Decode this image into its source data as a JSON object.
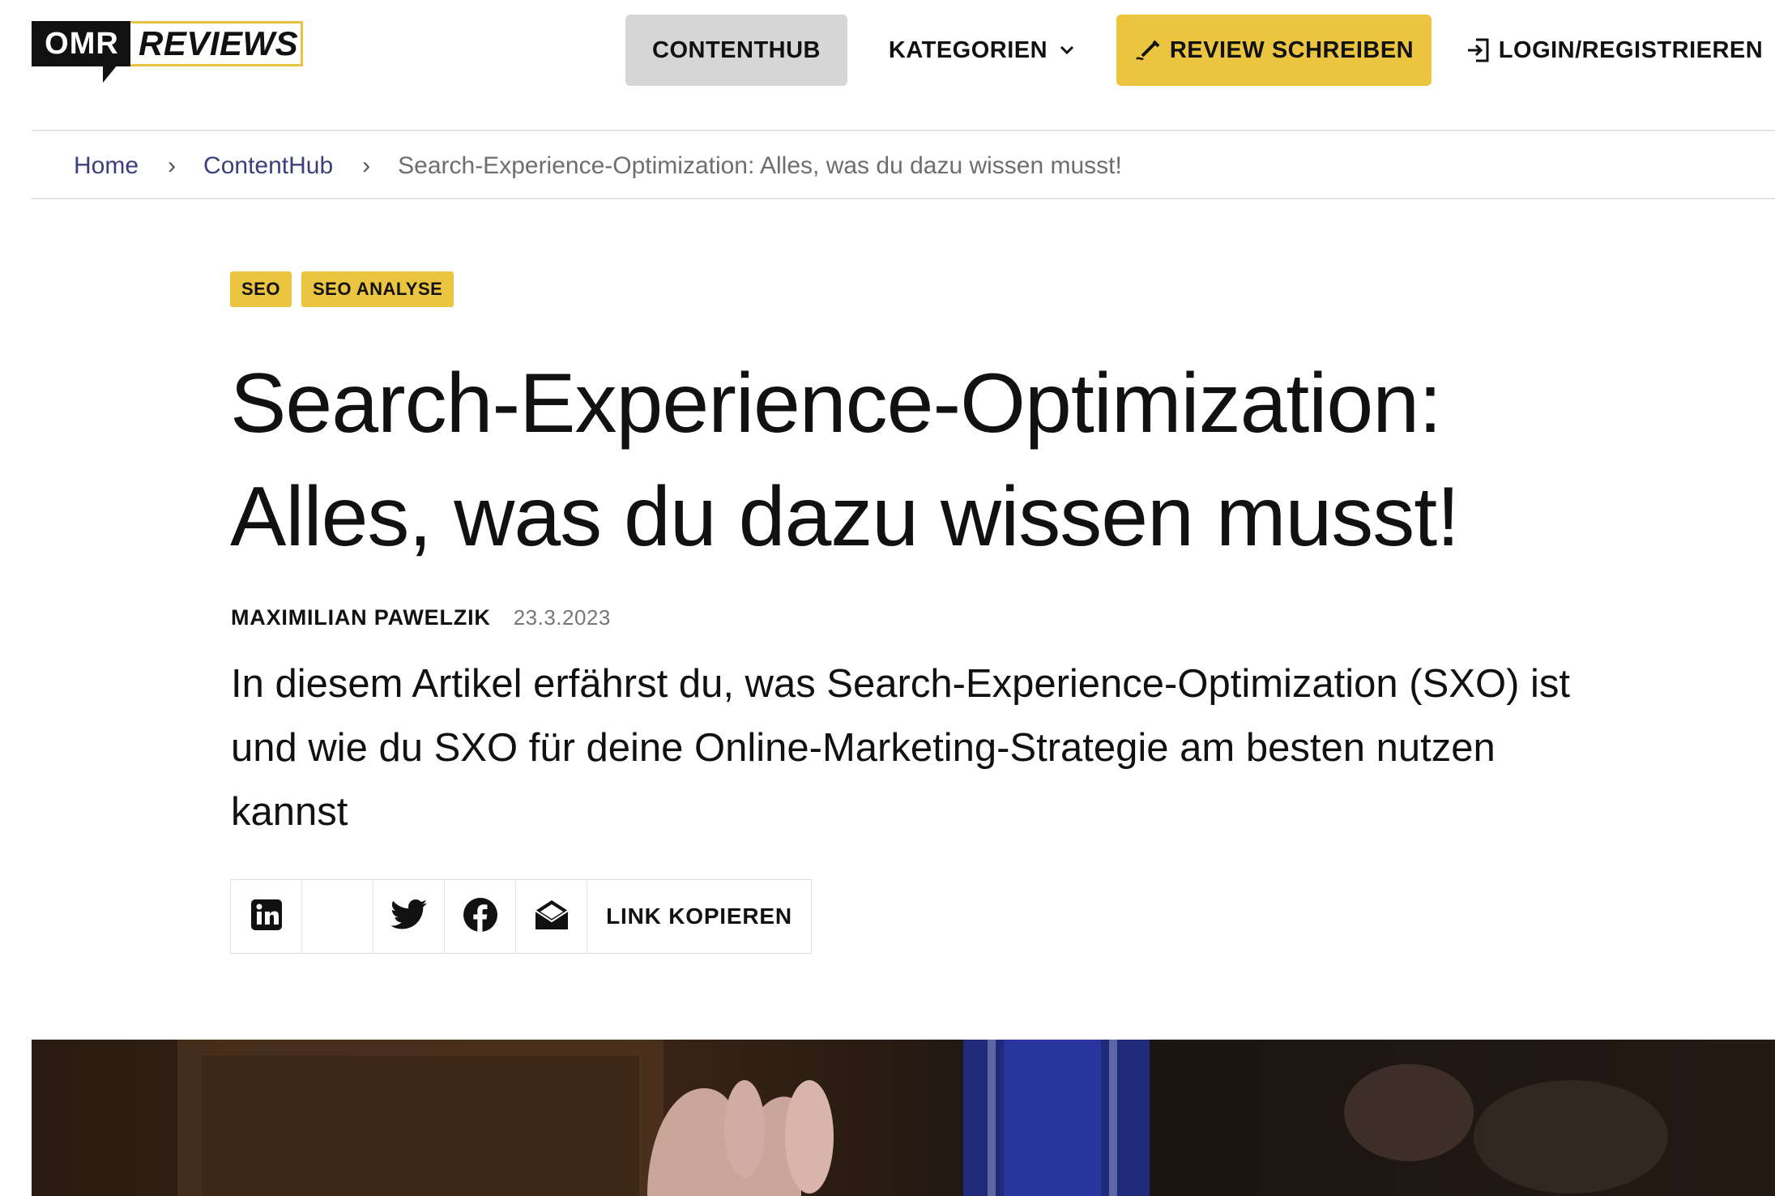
{
  "header": {
    "logo_left": "OMR",
    "logo_right": "REVIEWS",
    "nav": {
      "contenthub": "CONTENTHUB",
      "kategorien": "KATEGORIEN",
      "review": "REVIEW SCHREIBEN",
      "login": "LOGIN/REGISTRIEREN"
    },
    "colors": {
      "accent": "#ebc540",
      "nav_active_bg": "#d6d6d6"
    }
  },
  "breadcrumb": {
    "items": [
      "Home",
      "ContentHub"
    ],
    "separator": "›",
    "current": "Search-Experience-Optimization: Alles, was du dazu wissen musst!"
  },
  "article": {
    "tags": [
      "SEO",
      "SEO ANALYSE"
    ],
    "title_line1": "Search-Experience-Optimization:",
    "title_line2": "Alles, was du dazu wissen musst!",
    "author": "MAXIMILIAN PAWELZIK",
    "date": "23.3.2023",
    "lead": "In diesem Artikel erfährst du, was Search-Experience-Optimization (SXO) ist und wie du SXO für deine Online-Marketing-Strategie am besten nutzen kannst",
    "share": {
      "icons": [
        "linkedin-icon",
        "xing-icon",
        "twitter-icon",
        "facebook-icon",
        "mail-icon"
      ],
      "copy_label": "LINK KOPIEREN"
    }
  }
}
